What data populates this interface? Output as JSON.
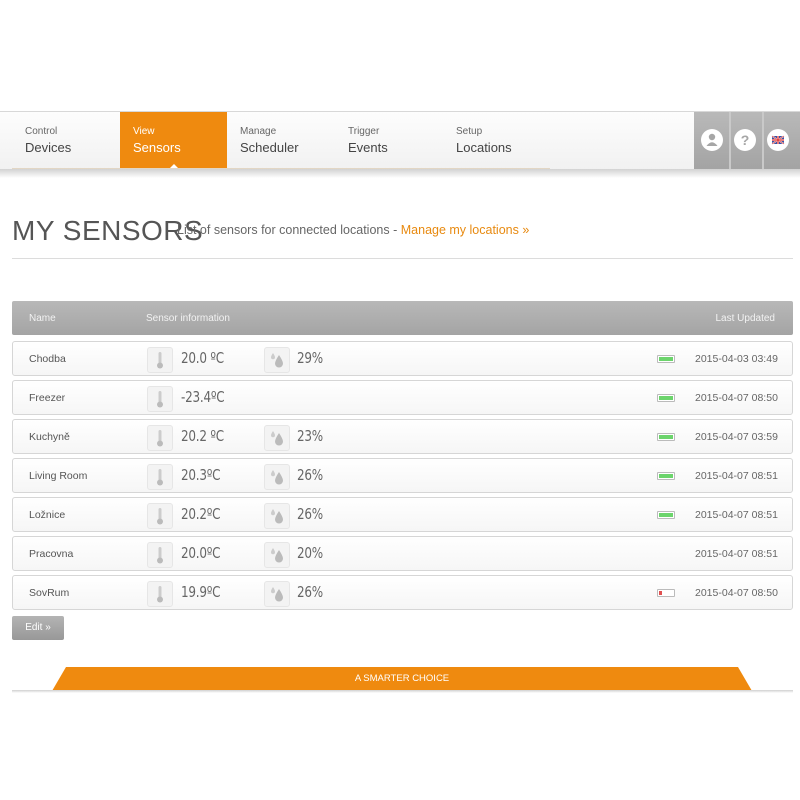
{
  "nav": {
    "items": [
      {
        "small": "Control",
        "label": "Devices"
      },
      {
        "small": "View",
        "label": "Sensors"
      },
      {
        "small": "Manage",
        "label": "Scheduler"
      },
      {
        "small": "Trigger",
        "label": "Events"
      },
      {
        "small": "Setup",
        "label": "Locations"
      }
    ],
    "active": "Sensors",
    "right_icons": [
      "user-icon",
      "help-icon",
      "uk-flag-icon"
    ]
  },
  "page": {
    "title": "MY SENSORS",
    "subtitle": "List of sensors for connected locations -",
    "manage_link": "Manage my locations »"
  },
  "table": {
    "headers": {
      "name": "Name",
      "info": "Sensor information",
      "updated": "Last Updated"
    },
    "rows": [
      {
        "name": "Chodba",
        "temp": "20.0 ºC",
        "humidity": "29%",
        "battery": "ok",
        "updated": "2015-04-03 03:49"
      },
      {
        "name": "Freezer",
        "temp": "-23.4ºC",
        "humidity": "",
        "battery": "ok",
        "updated": "2015-04-07 08:50"
      },
      {
        "name": "Kuchyně",
        "temp": "20.2 ºC",
        "humidity": "23%",
        "battery": "ok",
        "updated": "2015-04-07 03:59"
      },
      {
        "name": "Living Room",
        "temp": "20.3ºC",
        "humidity": "26%",
        "battery": "ok",
        "updated": "2015-04-07 08:51"
      },
      {
        "name": "Ložnice",
        "temp": "20.2ºC",
        "humidity": "26%",
        "battery": "ok",
        "updated": "2015-04-07 08:51"
      },
      {
        "name": "Pracovna",
        "temp": "20.0ºC",
        "humidity": "20%",
        "battery": "",
        "updated": "2015-04-07 08:51"
      },
      {
        "name": "SovRum",
        "temp": "19.9ºC",
        "humidity": "26%",
        "battery": "low",
        "updated": "2015-04-07 08:50"
      }
    ]
  },
  "edit_label": "Edit »",
  "footer": {
    "tagline": "A SMARTER CHOICE"
  },
  "colors": {
    "accent": "#ef8a0f",
    "battery_ok": "#6cd46c",
    "battery_low": "#e05050",
    "header_gray": "#a9a9a9"
  }
}
